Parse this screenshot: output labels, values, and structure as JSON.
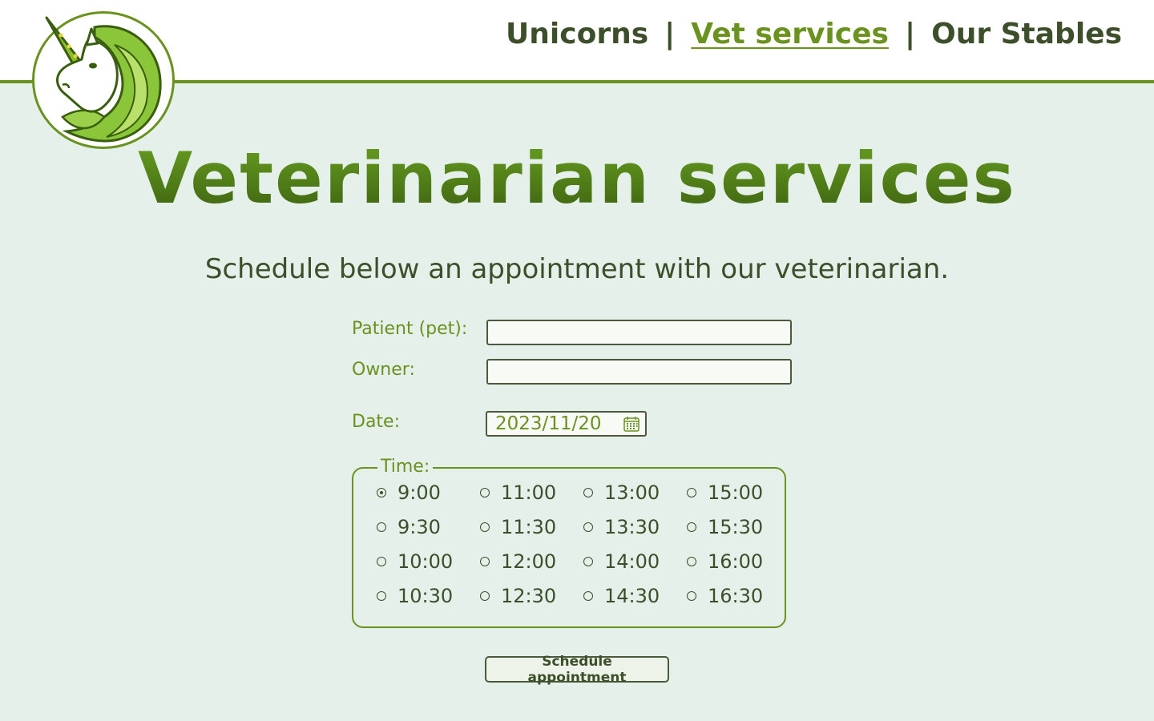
{
  "nav": {
    "items": [
      {
        "label": "Unicorns",
        "active": false
      },
      {
        "label": "Vet services",
        "active": true
      },
      {
        "label": "Our Stables",
        "active": false
      }
    ],
    "separator": "|"
  },
  "logo": {
    "icon": "unicorn-head-icon"
  },
  "main": {
    "title": "Veterinarian services",
    "subtitle": "Schedule below an appointment with our veterinarian."
  },
  "form": {
    "patient_label": "Patient (pet):",
    "patient_value": "",
    "owner_label": "Owner:",
    "owner_value": "",
    "date_label": "Date:",
    "date_value": "2023/11/20",
    "time_legend": "Time:",
    "time_options": [
      [
        "9:00",
        "11:00",
        "13:00",
        "15:00"
      ],
      [
        "9:30",
        "11:30",
        "13:30",
        "15:30"
      ],
      [
        "10:00",
        "12:00",
        "14:00",
        "16:00"
      ],
      [
        "10:30",
        "12:30",
        "14:30",
        "16:30"
      ]
    ],
    "selected_time": "9:00",
    "submit_label": "Schedule appointment"
  },
  "colors": {
    "accent": "#6a921f",
    "text_dark": "#3d4f2a",
    "background": "#e5f0ea",
    "header_bg": "#ffffff"
  }
}
